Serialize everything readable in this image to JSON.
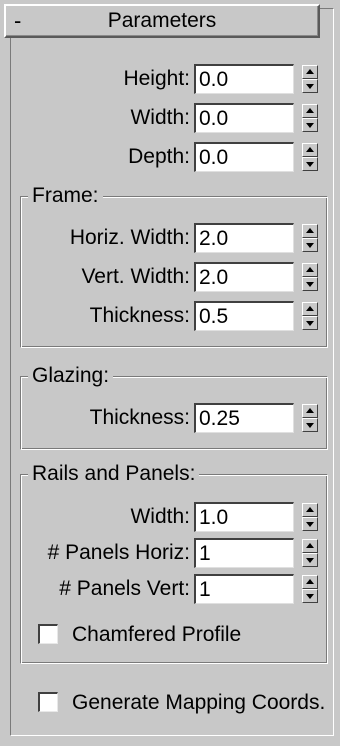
{
  "panel": {
    "collapse_symbol": "-",
    "title": "Parameters"
  },
  "dimensions": {
    "height": {
      "label": "Height:",
      "value": "0.0"
    },
    "width": {
      "label": "Width:",
      "value": "0.0"
    },
    "depth": {
      "label": "Depth:",
      "value": "0.0"
    }
  },
  "frame": {
    "title": "Frame:",
    "horiz_width": {
      "label": "Horiz. Width:",
      "value": "2.0"
    },
    "vert_width": {
      "label": "Vert. Width:",
      "value": "2.0"
    },
    "thickness": {
      "label": "Thickness:",
      "value": "0.5"
    }
  },
  "glazing": {
    "title": "Glazing:",
    "thickness": {
      "label": "Thickness:",
      "value": "0.25"
    }
  },
  "rails": {
    "title": "Rails and Panels:",
    "width": {
      "label": "Width:",
      "value": "1.0"
    },
    "panels_horiz": {
      "label": "# Panels Horiz:",
      "value": "1"
    },
    "panels_vert": {
      "label": "# Panels Vert:",
      "value": "1"
    },
    "chamfered": {
      "label": "Chamfered Profile",
      "checked": false
    }
  },
  "mapping": {
    "label": "Generate Mapping Coords.",
    "checked": false
  }
}
